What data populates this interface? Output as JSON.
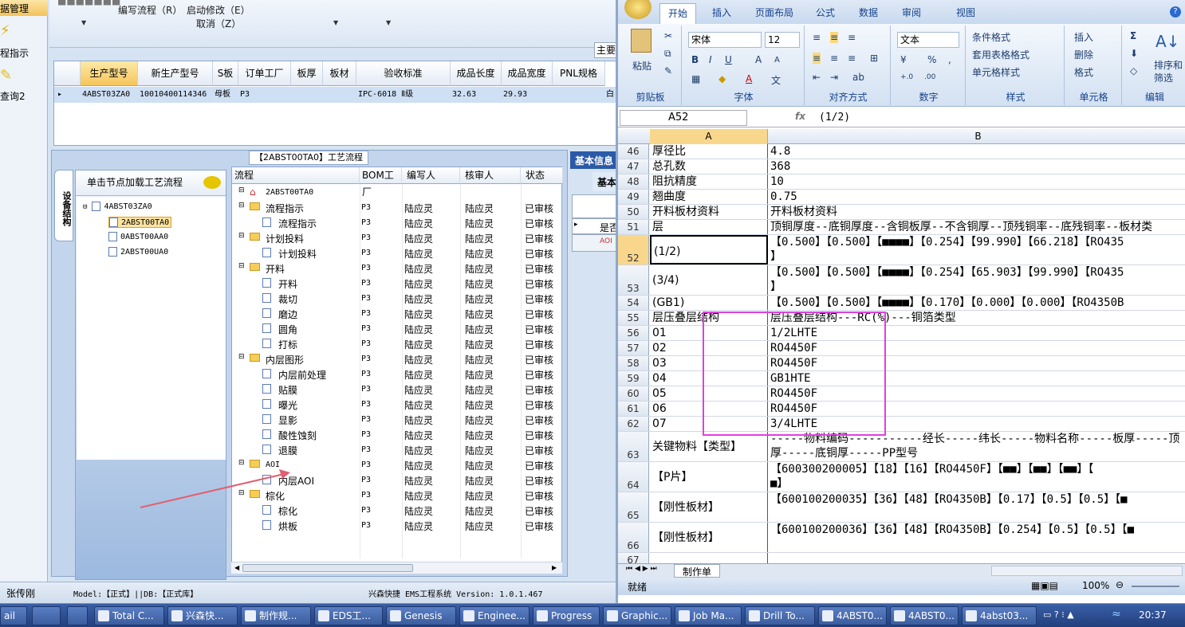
{
  "nav": {
    "title": "据管理",
    "item1": "程指示",
    "item2": "查询2"
  },
  "toolbar": {
    "row1": [
      "■■■■■■■",
      "编写流程（R）",
      "启动修改（E）",
      "■■■■■■■",
      "■■■■■■",
      "■■■■■■",
      "■■■■■■",
      "■■■■■■",
      "■■■■■■"
    ],
    "cancel": "取消（Z）",
    "main_label": "主要"
  },
  "grid1": {
    "headers": [
      "生产型号",
      "新生产型号",
      "S板",
      "订单工厂",
      "板厚",
      "板材",
      "验收标准",
      "成品长度",
      "成品宽度",
      "PNL规格"
    ],
    "row": [
      "4ABST03ZA0",
      "10010400114346",
      "母板",
      "P3",
      "",
      "",
      "IPC-6018 Ⅱ级",
      "32.63",
      "29.93",
      ""
    ],
    "extra": "白"
  },
  "flow_title": "【2ABST00TA0】工艺流程",
  "tree": {
    "vtab": "设备结构",
    "header": "单击节点加载工艺流程",
    "root": "4ABST03ZA0",
    "children": [
      "2ABST00TA0",
      "0ABST00AA0",
      "2ABST00UA0"
    ]
  },
  "flowgrid": {
    "headers": [
      "流程",
      "BOM工厂",
      "编写人",
      "核审人",
      "状态"
    ],
    "root": "2ABST00TA0",
    "rows": [
      {
        "name": "流程指示",
        "folder": true,
        "bom": "P3",
        "writer": "陆应灵",
        "reviewer": "陆应灵",
        "status": "已审核"
      },
      {
        "name": "流程指示",
        "folder": false,
        "bom": "P3",
        "writer": "陆应灵",
        "reviewer": "陆应灵",
        "status": "已审核"
      },
      {
        "name": "计划投料",
        "folder": true,
        "bom": "P3",
        "writer": "陆应灵",
        "reviewer": "陆应灵",
        "status": "已审核"
      },
      {
        "name": "计划投料",
        "folder": false,
        "bom": "P3",
        "writer": "陆应灵",
        "reviewer": "陆应灵",
        "status": "已审核"
      },
      {
        "name": "开料",
        "folder": true,
        "bom": "P3",
        "writer": "陆应灵",
        "reviewer": "陆应灵",
        "status": "已审核"
      },
      {
        "name": "开料",
        "folder": false,
        "bom": "P3",
        "writer": "陆应灵",
        "reviewer": "陆应灵",
        "status": "已审核"
      },
      {
        "name": "裁切",
        "folder": false,
        "bom": "P3",
        "writer": "陆应灵",
        "reviewer": "陆应灵",
        "status": "已审核"
      },
      {
        "name": "磨边",
        "folder": false,
        "bom": "P3",
        "writer": "陆应灵",
        "reviewer": "陆应灵",
        "status": "已审核"
      },
      {
        "name": "圆角",
        "folder": false,
        "bom": "P3",
        "writer": "陆应灵",
        "reviewer": "陆应灵",
        "status": "已审核"
      },
      {
        "name": "打标",
        "folder": false,
        "bom": "P3",
        "writer": "陆应灵",
        "reviewer": "陆应灵",
        "status": "已审核"
      },
      {
        "name": "内层图形",
        "folder": true,
        "bom": "P3",
        "writer": "陆应灵",
        "reviewer": "陆应灵",
        "status": "已审核"
      },
      {
        "name": "内层前处理",
        "folder": false,
        "bom": "P3",
        "writer": "陆应灵",
        "reviewer": "陆应灵",
        "status": "已审核"
      },
      {
        "name": "贴膜",
        "folder": false,
        "bom": "P3",
        "writer": "陆应灵",
        "reviewer": "陆应灵",
        "status": "已审核"
      },
      {
        "name": "曝光",
        "folder": false,
        "bom": "P3",
        "writer": "陆应灵",
        "reviewer": "陆应灵",
        "status": "已审核"
      },
      {
        "name": "显影",
        "folder": false,
        "bom": "P3",
        "writer": "陆应灵",
        "reviewer": "陆应灵",
        "status": "已审核"
      },
      {
        "name": "酸性蚀刻",
        "folder": false,
        "bom": "P3",
        "writer": "陆应灵",
        "reviewer": "陆应灵",
        "status": "已审核"
      },
      {
        "name": "退膜",
        "folder": false,
        "bom": "P3",
        "writer": "陆应灵",
        "reviewer": "陆应灵",
        "status": "已审核"
      },
      {
        "name": "AOI",
        "folder": true,
        "bom": "P3",
        "writer": "陆应灵",
        "reviewer": "陆应灵",
        "status": "已审核"
      },
      {
        "name": "内层AOI",
        "folder": false,
        "bom": "P3",
        "writer": "陆应灵",
        "reviewer": "陆应灵",
        "status": "已审核"
      },
      {
        "name": "棕化",
        "folder": true,
        "bom": "P3",
        "writer": "陆应灵",
        "reviewer": "陆应灵",
        "status": "已审核"
      },
      {
        "name": "棕化",
        "folder": false,
        "bom": "P3",
        "writer": "陆应灵",
        "reviewer": "陆应灵",
        "status": "已审核"
      },
      {
        "name": "烘板",
        "folder": false,
        "bom": "P3",
        "writer": "陆应灵",
        "reviewer": "陆应灵",
        "status": "已审核"
      }
    ]
  },
  "basic_info": {
    "tab": "基本信息",
    "sub": "基本",
    "row_label": "是否",
    "row2": "AOI"
  },
  "status": {
    "user": "张传刚",
    "model": "Model:【正式】||DB:【正式库】",
    "system": "兴森快捷 EMS工程系统 Version: 1.0.1.467"
  },
  "excel": {
    "tabs": [
      "开始",
      "插入",
      "页面布局",
      "公式",
      "数据",
      "审阅",
      "视图"
    ],
    "paste": "粘贴",
    "font_name": "宋体",
    "font_size": "12",
    "number_format": "文本",
    "styles": [
      "条件格式",
      "套用表格格式",
      "单元格样式"
    ],
    "cells": [
      "插入",
      "删除",
      "格式"
    ],
    "sort": "排序和筛选",
    "group_labels": [
      "剪贴板",
      "字体",
      "对齐方式",
      "数字",
      "样式",
      "单元格",
      "编辑"
    ],
    "name_box": "A52",
    "formula": "(1/2)",
    "col_a": "A",
    "col_b": "B",
    "rows": [
      {
        "n": "46",
        "a": "厚径比",
        "b": "4.8"
      },
      {
        "n": "47",
        "a": "总孔数",
        "b": "368"
      },
      {
        "n": "48",
        "a": "阻抗精度",
        "b": "10"
      },
      {
        "n": "49",
        "a": "翘曲度",
        "b": "0.75"
      },
      {
        "n": "50",
        "a": "开料板材资料",
        "b": "开料板材资料"
      },
      {
        "n": "51",
        "a": "层",
        "b": "顶铜厚度--底铜厚度--含铜板厚--不含铜厚--顶残铜率--底残铜率--板材类"
      },
      {
        "n": "52",
        "a": "(1/2)",
        "b": "【0.500】【0.500】【■■■■】【0.254】【99.990】【66.218】【RO435",
        "b2": "】"
      },
      {
        "n": "53",
        "a": "(3/4)",
        "b": "【0.500】【0.500】【■■■■】【0.254】【65.903】【99.990】【RO435",
        "b2": "】"
      },
      {
        "n": "54",
        "a": "(GB1)",
        "b": "【0.500】【0.500】【■■■■】【0.170】【0.000】【0.000】【RO4350B"
      },
      {
        "n": "55",
        "a": "层压叠层结构",
        "b": "层压叠层结构---RC(%)---铜箔类型"
      },
      {
        "n": "56",
        "a": "01",
        "b": "1/2LHTE"
      },
      {
        "n": "57",
        "a": "02",
        "b": "RO4450F"
      },
      {
        "n": "58",
        "a": "03",
        "b": "RO4450F"
      },
      {
        "n": "59",
        "a": "04",
        "b": "GB1HTE"
      },
      {
        "n": "60",
        "a": "05",
        "b": "RO4450F"
      },
      {
        "n": "61",
        "a": "06",
        "b": "RO4450F"
      },
      {
        "n": "62",
        "a": "07",
        "b": "3/4LHTE"
      },
      {
        "n": "63",
        "a": "关键物料【类型】",
        "b": "-----物料编码-----------经长-----纬长-----物料名称-----板厚-----顶",
        "b2": "厚-----底铜厚-----PP型号"
      },
      {
        "n": "64",
        "a": "【P片】",
        "b": "【600300200005】【18】【16】【RO4450F】【■■】【■■】【■■】【",
        "b2": "■】"
      },
      {
        "n": "65",
        "a": "【刚性板材】",
        "b": "【600100200035】【36】【48】【RO4350B】【0.17】【0.5】【0.5】【■"
      },
      {
        "n": "66",
        "a": "【刚性板材】",
        "b": "【600100200036】【36】【48】【RO4350B】【0.254】【0.5】【0.5】【■"
      },
      {
        "n": "67",
        "a": "",
        "b": ""
      }
    ],
    "sheet_tab": "制作单",
    "status_ready": "就绪",
    "zoom": "100%"
  },
  "taskbar": {
    "items": [
      "ail",
      "",
      "",
      "Total C...",
      "兴森快...",
      "制作规...",
      "EDS工...",
      "Genesis",
      "Enginee...",
      "Progress",
      "Graphic...",
      "Job Ma...",
      "Drill To...",
      "4ABST0...",
      "4ABST0...",
      "4abst03..."
    ],
    "clock": "20:37"
  }
}
